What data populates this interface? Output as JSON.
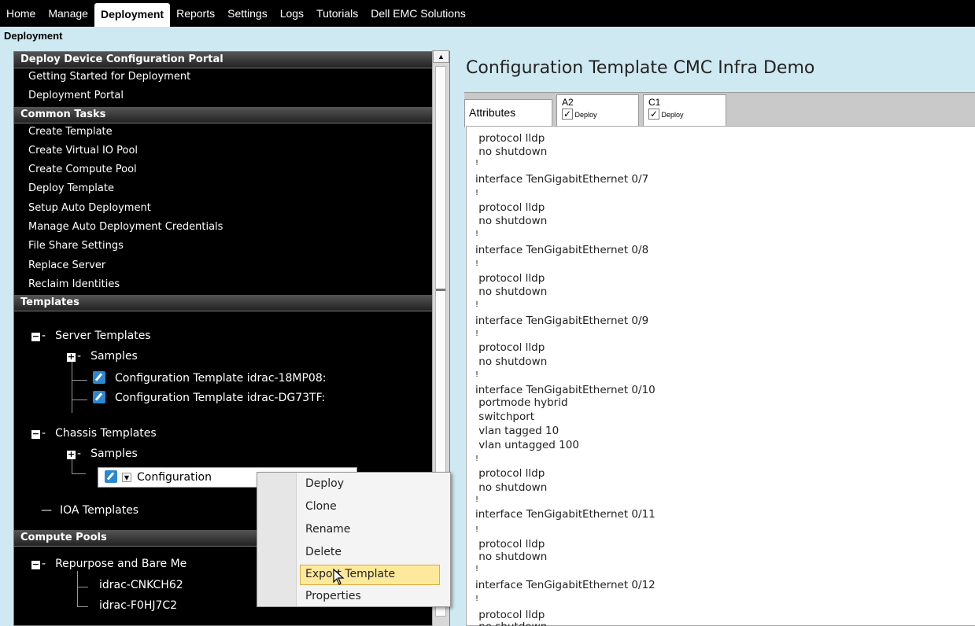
{
  "nav": {
    "tabs": [
      "Home",
      "Manage",
      "Deployment",
      "Reports",
      "Settings",
      "Logs",
      "Tutorials",
      "Dell EMC Solutions"
    ],
    "active": "Deployment"
  },
  "breadcrumb": "Deployment",
  "sidebar": {
    "portal_header": "Deploy Device Configuration Portal",
    "portal_items": [
      "Getting Started for Deployment",
      "Deployment Portal"
    ],
    "common_header": "Common Tasks",
    "common_items": [
      "Create Template",
      "Create Virtual IO Pool",
      "Create Compute Pool",
      "Deploy Template",
      "Setup Auto Deployment",
      "Manage Auto Deployment Credentials",
      "File Share Settings",
      "Replace Server",
      "Reclaim Identities"
    ],
    "templates_header": "Templates",
    "server_templates": "Server Templates",
    "samples_1": "Samples",
    "server_tmpl_1": "Configuration Template idrac-18MP08:",
    "server_tmpl_2": "Configuration Template idrac-DG73TF:",
    "chassis_templates": "Chassis Templates",
    "samples_2": "Samples",
    "chassis_tmpl_selected": "Configuration",
    "ioa_templates": "IOA Templates",
    "compute_header": "Compute Pools",
    "pool_name": "Repurpose and Bare Me",
    "pool_items": [
      "idrac-CNKCH62",
      "idrac-F0HJ7C2"
    ]
  },
  "context_menu": {
    "items": [
      "Deploy",
      "Clone",
      "Rename",
      "Delete",
      "Export Template",
      "Properties"
    ],
    "highlighted": "Export Template"
  },
  "main": {
    "title": "Configuration Template CMC Infra Demo",
    "tabs": {
      "attributes": "Attributes",
      "a2_label": "A2",
      "a2_sub": "Deploy",
      "c1_label": "C1",
      "c1_sub": "Deploy"
    },
    "config_lines": [
      " protocol lldp",
      " no shutdown",
      "!",
      "interface TenGigabitEthernet 0/7",
      "!",
      " protocol lldp",
      " no shutdown",
      "!",
      "interface TenGigabitEthernet 0/8",
      "!",
      " protocol lldp",
      " no shutdown",
      "!",
      "interface TenGigabitEthernet 0/9",
      "!",
      " protocol lldp",
      " no shutdown",
      "!",
      "interface TenGigabitEthernet 0/10",
      " portmode hybrid",
      " switchport",
      " vlan tagged 10",
      " vlan untagged 100",
      "!",
      " protocol lldp",
      " no shutdown",
      "!",
      "interface TenGigabitEthernet 0/11",
      "!",
      " protocol lldp",
      " no shutdown",
      "!",
      "interface TenGigabitEthernet 0/12",
      "!",
      " protocol lldp",
      " no shutdown"
    ]
  },
  "colors": {
    "nav_bg": "#000000",
    "page_bg": "#cfe9f3",
    "highlight": "#fde99b",
    "icon_blue": "#2a88d3"
  },
  "icons": [
    "template-icon",
    "expand-icon",
    "collapse-icon",
    "dropdown-icon",
    "checkbox-icon",
    "cursor-icon"
  ]
}
